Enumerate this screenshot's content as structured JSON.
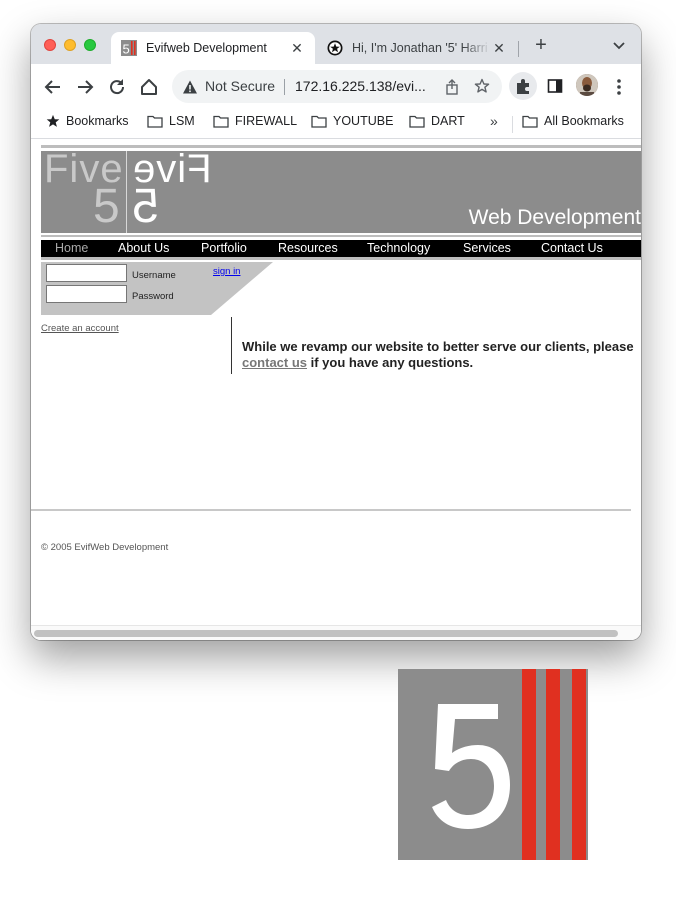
{
  "browser": {
    "tabs": [
      {
        "title": "Evifweb Development",
        "active": true
      },
      {
        "title": "Hi, I'm Jonathan '5' Harri",
        "active": false
      }
    ],
    "omnibox": {
      "security_label": "Not Secure",
      "url": "172.16.225.138/evi..."
    },
    "bookmarks": [
      {
        "label": "Bookmarks",
        "icon": "star-icon"
      },
      {
        "label": "LSM",
        "icon": "folder-icon"
      },
      {
        "label": "FIREWALL",
        "icon": "folder-icon"
      },
      {
        "label": "YOUTUBE",
        "icon": "folder-icon"
      },
      {
        "label": "DART",
        "icon": "folder-icon"
      }
    ],
    "more_bookmarks": "»",
    "all_bookmarks": "All Bookmarks"
  },
  "site": {
    "logo": {
      "word": "Five",
      "number": "5"
    },
    "tagline": "Web Development",
    "nav": [
      {
        "label": "Home",
        "active": true
      },
      {
        "label": "About Us",
        "active": false
      },
      {
        "label": "Portfolio",
        "active": false
      },
      {
        "label": "Resources",
        "active": false
      },
      {
        "label": "Technology",
        "active": false
      },
      {
        "label": "Services",
        "active": false
      },
      {
        "label": "Contact Us",
        "active": false
      }
    ],
    "login": {
      "username_label": "Username",
      "password_label": "Password",
      "username_value": "",
      "password_value": "",
      "signin_label": "sign in"
    },
    "create_account": "Create an account",
    "message": {
      "before": "While we revamp our website to better serve our clients, please ",
      "link": "contact us",
      "after": " if you have any questions."
    },
    "copyright": "© 2005 EvifWeb Development"
  },
  "colors": {
    "banner_gray": "#8c8c8c",
    "logo_red": "#e03020",
    "nav_black": "#000000"
  }
}
